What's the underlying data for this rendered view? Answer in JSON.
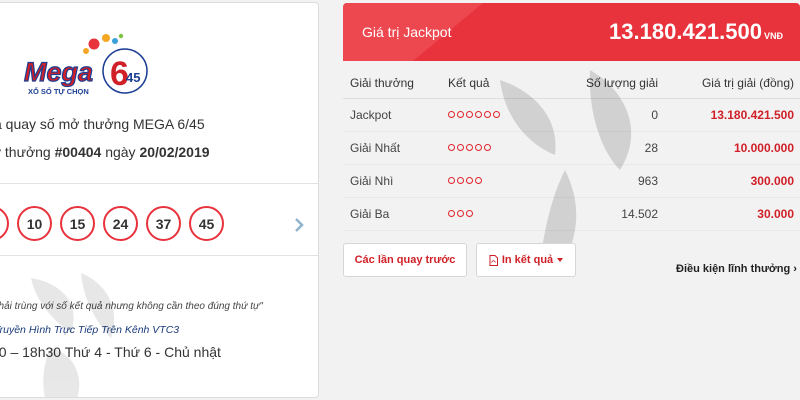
{
  "logo": {
    "brand": "Mega",
    "number_top": "6",
    "number_bottom": "45",
    "tagline": "XỔ SỐ TỰ CHỌN"
  },
  "left": {
    "title_text": "ả quay số mở thưởng MEGA 6/45",
    "draw_prefix": "y thưởng ",
    "draw_number": "#00404",
    "draw_mid": " ngày ",
    "draw_date": "20/02/2019",
    "numbers": [
      "",
      "10",
      "15",
      "24",
      "37",
      "45"
    ],
    "note": "phải trùng với số kết quả nhưng không cần theo đúng thứ tự\"",
    "channel": "Truyền Hình Trực Tiếp Trên Kênh VTC3",
    "schedule": "00 – 18h30 Thứ 4 - Thứ 6 - Chủ nhật"
  },
  "jackpot": {
    "label": "Giá trị Jackpot",
    "value": "13.180.421.500",
    "currency": "VNĐ"
  },
  "table": {
    "headers": [
      "Giải thưởng",
      "Kết quả",
      "Số lượng giải",
      "Giá trị giải (đồng)"
    ],
    "rows": [
      {
        "name": "Jackpot",
        "matches": 6,
        "count": "0",
        "value": "13.180.421.500"
      },
      {
        "name": "Giải Nhất",
        "matches": 5,
        "count": "28",
        "value": "10.000.000"
      },
      {
        "name": "Giải Nhì",
        "matches": 4,
        "count": "963",
        "value": "300.000"
      },
      {
        "name": "Giải Ba",
        "matches": 3,
        "count": "14.502",
        "value": "30.000"
      }
    ]
  },
  "buttons": {
    "previous": "Các lần quay trước",
    "print": "In kết quả",
    "conditions": "Điều kiện lĩnh thưởng"
  },
  "colors": {
    "accent_red": "#e8323c",
    "value_red": "#d01f27",
    "channel_blue": "#1a3a7a"
  },
  "icons": {
    "pdf": "pdf-icon",
    "chevron": "chevron-right-icon",
    "caret": "caret-down-icon"
  }
}
